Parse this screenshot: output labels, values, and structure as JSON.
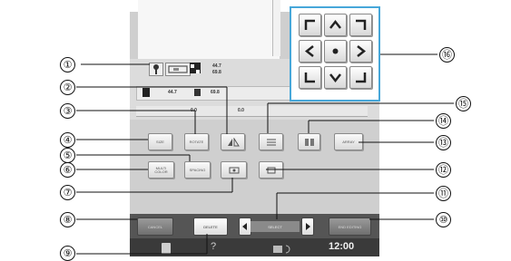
{
  "screen": {
    "size_value_1": "44.7",
    "size_value_2": "69.8",
    "row_value_1": "44.7",
    "row_value_2": "69.8",
    "row_value_3": "0.0",
    "row_value_4": "0.0"
  },
  "buttons": {
    "size": "SIZE",
    "rotate": "ROTATE",
    "mirror": "",
    "density": "",
    "border": "",
    "array": "ARRAY",
    "multi_color": "MULTI COLOR",
    "spacing": "SPACING",
    "select_center": "",
    "center_alt": "",
    "cancel": "CANCEL",
    "delete": "DELETE",
    "select": "SELECT",
    "memory": "MEMORY",
    "end_editing": "END EDITING"
  },
  "footer": {
    "help_glyph": "?",
    "time": "12:00"
  },
  "callouts": [
    "①",
    "②",
    "③",
    "④",
    "⑤",
    "⑥",
    "⑦",
    "⑧",
    "⑨",
    "⑩",
    "⑪",
    "⑫",
    "⑬",
    "⑭",
    "⑮",
    "⑯"
  ],
  "icons": {
    "pad": [
      "corner-up-left-icon",
      "arrow-up-icon",
      "corner-up-right-icon",
      "arrow-left-icon",
      "center-dot-icon",
      "arrow-right-icon",
      "corner-down-left-icon",
      "arrow-down-icon",
      "corner-down-right-icon"
    ]
  },
  "colors": {
    "pad_border": "#47a7d9",
    "screen_bg": "#cfcfcf",
    "footer_bg": "#3a3a3a"
  }
}
